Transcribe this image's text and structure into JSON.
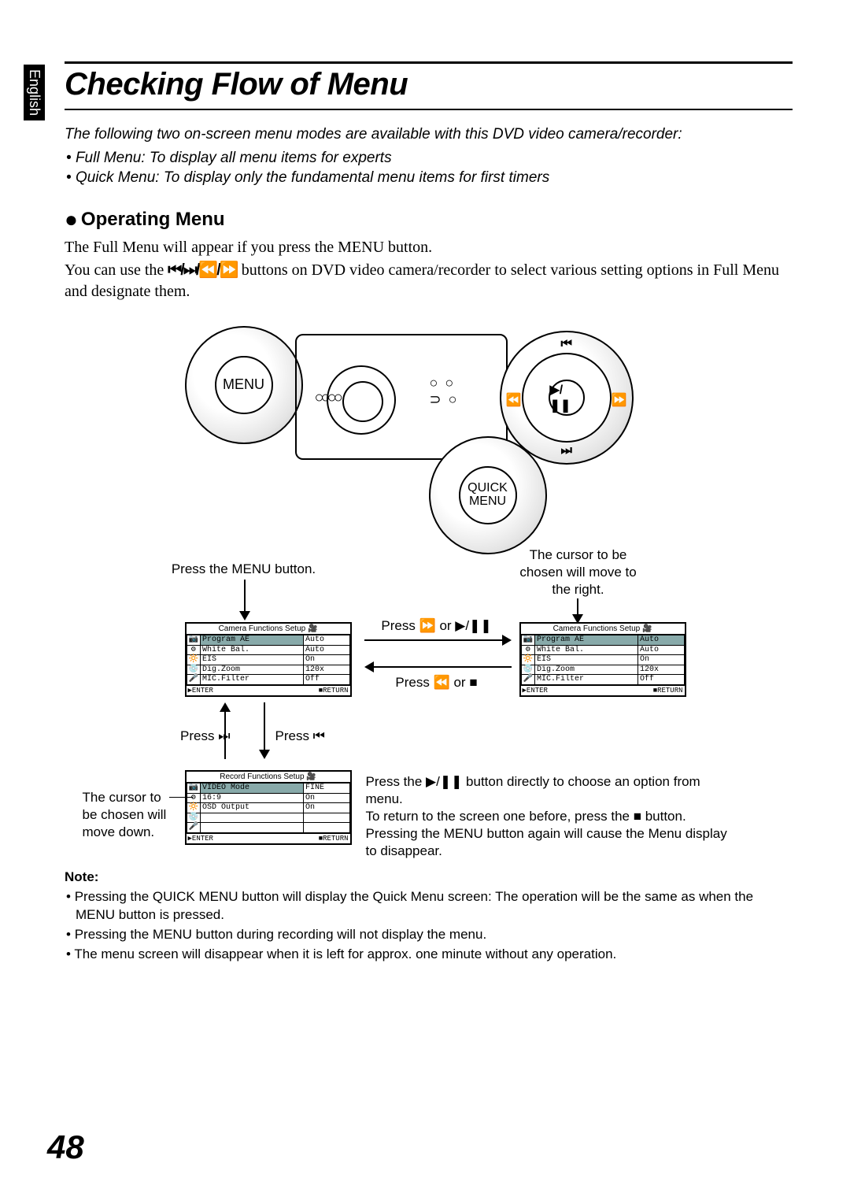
{
  "sidebar": {
    "lang": "English"
  },
  "title": "Checking Flow of Menu",
  "intro": "The following two on-screen menu modes are available with this DVD video camera/recorder:",
  "intro_items": [
    "Full Menu: To display all menu items for experts",
    "Quick Menu: To display only the fundamental menu items for first timers"
  ],
  "section_heading": "Operating Menu",
  "section_p1": "The Full Menu will appear if you press the MENU button.",
  "section_p2a": "You can use the ",
  "section_p2b": " buttons on DVD video camera/recorder to select various setting options in Full Menu and designate them.",
  "nav_symbols": "⏮/⏭/⏪/⏩",
  "diagram": {
    "menu_btn": "MENU",
    "quick_menu_btn_l1": "QUICK",
    "quick_menu_btn_l2": "MENU",
    "navpad": {
      "up": "⏮",
      "down": "⏭",
      "left": "⏪",
      "right": "⏩",
      "center": "▶/❚❚"
    },
    "caption_press_menu": "Press the MENU button.",
    "caption_cursor_right_l1": "The cursor to be",
    "caption_cursor_right_l2": "chosen will move to",
    "caption_cursor_right_l3": "the right.",
    "caption_press_fwd": "Press ⏩ or ▶/❚❚",
    "caption_press_back": "Press ⏪ or ■",
    "caption_press_next": "Press ⏭",
    "caption_press_prev": "Press ⏮",
    "caption_cursor_down_l1": "The cursor to",
    "caption_cursor_down_l2": "be chosen will",
    "caption_cursor_down_l3": "move down.",
    "instr_p1": "Press the ▶/❚❚ button directly to choose an option from menu.",
    "instr_p2": "To return to the screen one before, press the ■ button.",
    "instr_p3": "Pressing the MENU button again will cause the Menu display to disappear.",
    "screen_cam": {
      "title": "Camera Functions Setup",
      "rows": [
        {
          "label": "Program AE",
          "value": "Auto",
          "hl": "label"
        },
        {
          "label": "White Bal.",
          "value": "Auto"
        },
        {
          "label": "EIS",
          "value": "On"
        },
        {
          "label": "Dig.Zoom",
          "value": "120x"
        },
        {
          "label": "MIC.Filter",
          "value": "Off"
        }
      ],
      "footer_l": "▶ENTER",
      "footer_r": "■RETURN"
    },
    "screen_cam2": {
      "title": "Camera Functions Setup",
      "rows": [
        {
          "label": "Program AE",
          "value": "Auto",
          "hl": "row"
        },
        {
          "label": "White Bal.",
          "value": "Auto"
        },
        {
          "label": "EIS",
          "value": "On"
        },
        {
          "label": "Dig.Zoom",
          "value": "120x"
        },
        {
          "label": "MIC.Filter",
          "value": "Off"
        }
      ],
      "footer_l": "▶ENTER",
      "footer_r": "■RETURN"
    },
    "screen_rec": {
      "title": "Record Functions Setup",
      "rows": [
        {
          "label": "VIDEO Mode",
          "value": "FINE",
          "hl": "label"
        },
        {
          "label": "16:9",
          "value": "On"
        },
        {
          "label": "OSD Output",
          "value": "On"
        },
        {
          "label": "",
          "value": ""
        },
        {
          "label": "",
          "value": ""
        }
      ],
      "footer_l": "▶ENTER",
      "footer_r": "■RETURN"
    }
  },
  "note": {
    "head": "Note:",
    "items": [
      "Pressing the QUICK MENU button will display the Quick Menu screen: The operation will be the same as when the MENU button is pressed.",
      "Pressing the MENU button during recording will not display the menu.",
      "The menu screen will disappear when it is left for approx. one minute without any operation."
    ]
  },
  "page_number": "48"
}
